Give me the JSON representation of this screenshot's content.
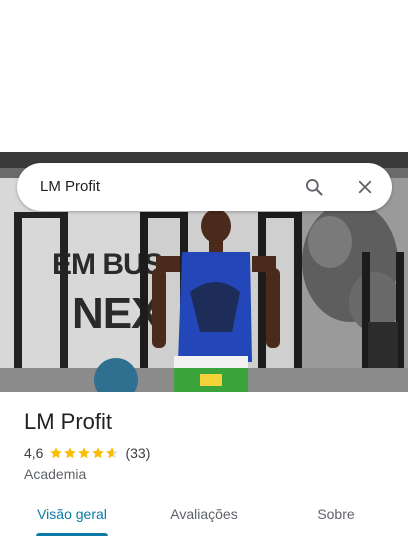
{
  "search": {
    "query": "LM Profit"
  },
  "place": {
    "name": "LM Profit",
    "rating": "4,6",
    "stars": 4.6,
    "review_count": "(33)",
    "category": "Academia"
  },
  "tabs": [
    {
      "label": "Visão geral",
      "active": true
    },
    {
      "label": "Avaliações",
      "active": false
    },
    {
      "label": "Sobre",
      "active": false
    }
  ],
  "photo": {
    "wall_text": "EM BUSC NEX"
  },
  "colors": {
    "accent": "#0b7ba5",
    "star": "#fbbc04",
    "text_primary": "#202124",
    "text_secondary": "#5f6368"
  },
  "icons": [
    "search-icon",
    "close-icon",
    "star-icon"
  ]
}
